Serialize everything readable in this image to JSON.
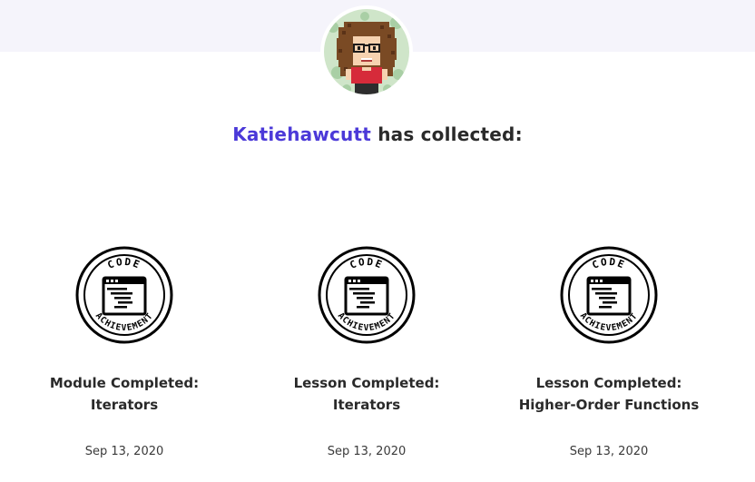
{
  "profile": {
    "username": "Katiehawcutt",
    "collected_suffix": " has collected:"
  },
  "badges": [
    {
      "icon_top_text": "CODE",
      "icon_bottom_text": "ACHIEVEMENT",
      "title": "Module Completed: Iterators",
      "date": "Sep 13, 2020"
    },
    {
      "icon_top_text": "CODE",
      "icon_bottom_text": "ACHIEVEMENT",
      "title": "Lesson Completed: Iterators",
      "date": "Sep 13, 2020"
    },
    {
      "icon_top_text": "CODE",
      "icon_bottom_text": "ACHIEVEMENT",
      "title": "Lesson Completed: Higher-Order Functions",
      "date": "Sep 13, 2020"
    }
  ],
  "colors": {
    "accent": "#4b39d8",
    "top_band": "#f5f4fb",
    "text": "#2a2a2a"
  },
  "icons": {
    "avatar": "pixel-art-avatar-icon",
    "badge": "code-achievement-badge-icon"
  }
}
